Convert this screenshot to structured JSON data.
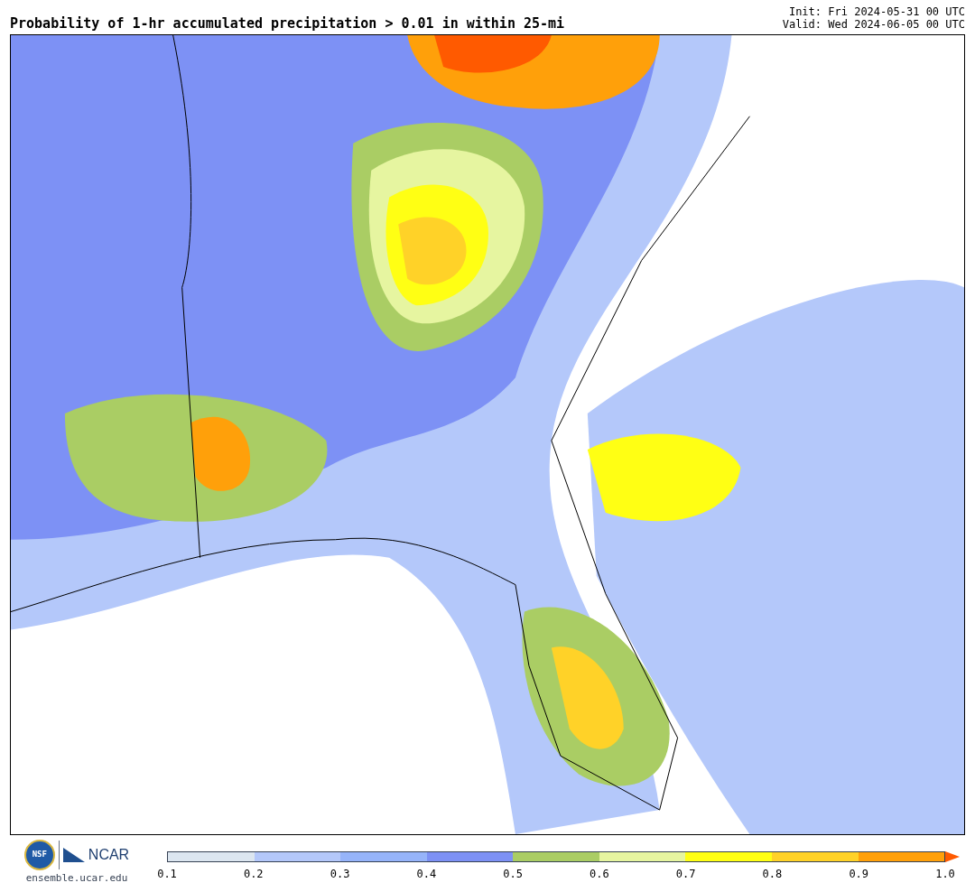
{
  "title": "Probability of 1-hr accumulated precipitation > 0.01 in within 25-mi",
  "init": "Init: Fri 2024-05-31 00 UTC",
  "valid": "Valid: Wed 2024-06-05 00 UTC",
  "footer": {
    "logo_text": "NSF",
    "org": "NCAR",
    "site": "ensemble.ucar.edu"
  },
  "colorbar": {
    "bins": [
      {
        "color": "#dce6f0"
      },
      {
        "color": "#b4c8fa"
      },
      {
        "color": "#96b4fa"
      },
      {
        "color": "#7d91f5"
      },
      {
        "color": "#aacd64"
      },
      {
        "color": "#e6f5a0"
      },
      {
        "color": "#ffff14"
      },
      {
        "color": "#ffd228"
      },
      {
        "color": "#ffa00a"
      }
    ],
    "extend_arrow": {
      "color": "#ff5a00"
    },
    "ticks": [
      "0.1",
      "0.2",
      "0.3",
      "0.4",
      "0.5",
      "0.6",
      "0.7",
      "0.8",
      "0.9",
      "1.0"
    ]
  }
}
